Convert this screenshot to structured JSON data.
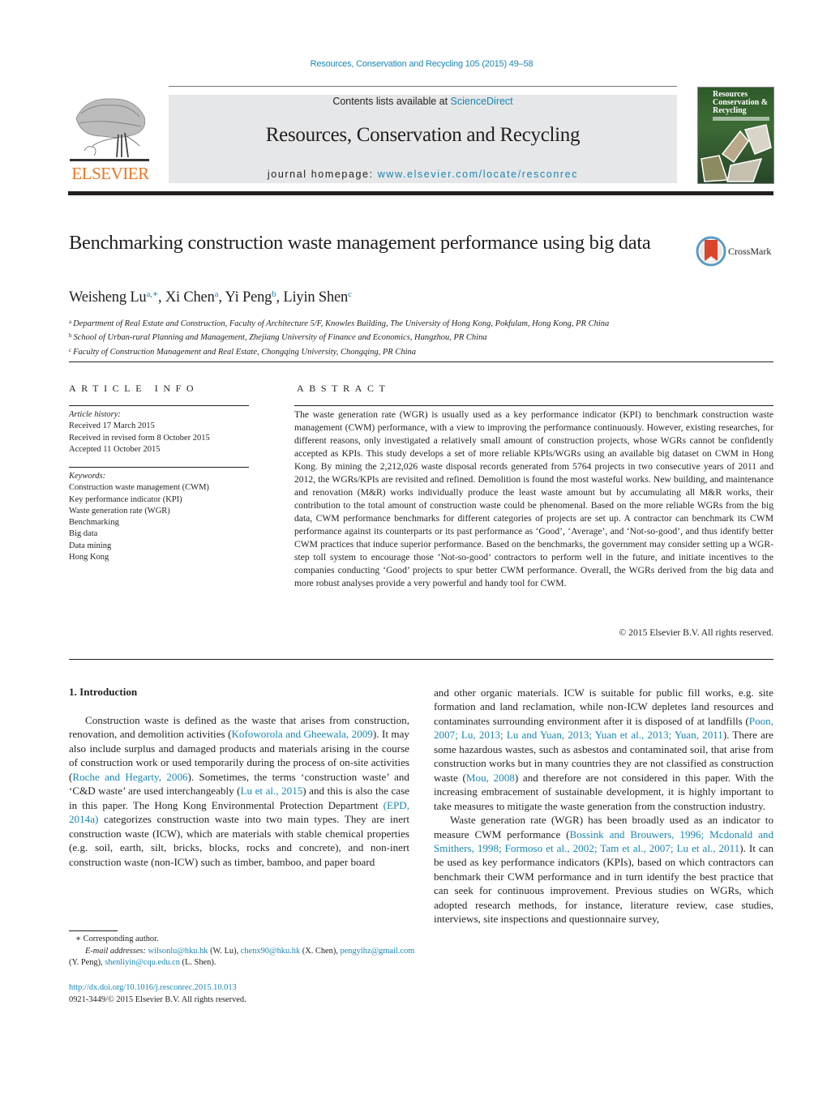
{
  "journal_citation": "Resources, Conservation and Recycling 105 (2015) 49–58",
  "publisher": {
    "logo_text": "ELSEVIER",
    "brand_color": "#e87722"
  },
  "banner": {
    "contents_prefix": "Contents lists available at ",
    "contents_link": "ScienceDirect",
    "journal_name": "Resources, Conservation and Recycling",
    "homepage_prefix": "journal homepage: ",
    "homepage_link": "www.elsevier.com/locate/resconrec"
  },
  "cover": {
    "title_lines": [
      "Resources",
      "Conservation &",
      "Recycling"
    ]
  },
  "crossmark_label": "CrossMark",
  "title": "Benchmarking construction waste management performance using big data",
  "authors": [
    {
      "name": "Weisheng Lu",
      "marks": "a,∗"
    },
    {
      "name": "Xi Chen",
      "marks": "a"
    },
    {
      "name": "Yi Peng",
      "marks": "b"
    },
    {
      "name": "Liyin Shen",
      "marks": "c"
    }
  ],
  "affiliations": [
    {
      "mark": "a",
      "text": "Department of Real Estate and Construction, Faculty of Architecture 5/F, Knowles Building, The University of Hong Kong, Pokfulam, Hong Kong, PR China"
    },
    {
      "mark": "b",
      "text": "School of Urban-rural Planning and Management, Zhejiang University of Finance and Economics, Hangzhou, PR China"
    },
    {
      "mark": "c",
      "text": "Faculty of Construction Management and Real Estate, Chongqing University, Chongqing, PR China"
    }
  ],
  "article_info": {
    "heading": "ARTICLE INFO",
    "history_label": "Article history:",
    "history": [
      "Received 17 March 2015",
      "Received in revised form 8 October 2015",
      "Accepted 11 October 2015"
    ],
    "keywords_label": "Keywords:",
    "keywords": [
      "Construction waste management (CWM)",
      "Key performance indicator (KPI)",
      "Waste generation rate (WGR)",
      "Benchmarking",
      "Big data",
      "Data mining",
      "Hong Kong"
    ]
  },
  "abstract": {
    "heading": "ABSTRACT",
    "text": "The waste generation rate (WGR) is usually used as a key performance indicator (KPI) to benchmark construction waste management (CWM) performance, with a view to improving the performance continuously. However, existing researches, for different reasons, only investigated a relatively small amount of construction projects, whose WGRs cannot be confidently accepted as KPIs. This study develops a set of more reliable KPIs/WGRs using an available big dataset on CWM in Hong Kong. By mining the 2,212,026 waste disposal records generated from 5764 projects in two consecutive years of 2011 and 2012, the WGRs/KPIs are revisited and refined. Demolition is found the most wasteful works. New building, and maintenance and renovation (M&R) works individually produce the least waste amount but by accumulating all M&R works, their contribution to the total amount of construction waste could be phenomenal. Based on the more reliable WGRs from the big data, CWM performance benchmarks for different categories of projects are set up. A contractor can benchmark its CWM performance against its counterparts or its past performance as ‘Good’, ‘Average’, and ‘Not-so-good’, and thus identify better CWM practices that induce superior performance. Based on the benchmarks, the government may consider setting up a WGR-step toll system to encourage those ‘Not-so-good’ contractors to perform well in the future, and initiate incentives to the companies conducting ‘Good’ projects to spur better CWM performance. Overall, the WGRs derived from the big data and more robust analyses provide a very powerful and handy tool for CWM.",
    "copyright": "© 2015 Elsevier B.V. All rights reserved."
  },
  "introduction": {
    "heading": "1.  Introduction",
    "left_p1": [
      {
        "t": "Construction waste is defined as the waste that arises from construction, renovation, and demolition activities ("
      },
      {
        "t": "Kofoworola and Gheewala, 2009",
        "link": true
      },
      {
        "t": "). It may also include surplus and damaged products and materials arising in the course of construction work or used temporarily during the process of on-site activities ("
      },
      {
        "t": "Roche and Hegarty, 2006",
        "link": true
      },
      {
        "t": "). Sometimes, the terms ‘construction waste’ and ‘C&D waste’ are used interchangeably ("
      },
      {
        "t": "Lu et al., 2015",
        "link": true
      },
      {
        "t": ") and this is also the case in this paper. The Hong Kong Environmental Protection Department "
      },
      {
        "t": "(EPD, 2014a)",
        "link": true
      },
      {
        "t": " categorizes construction waste into two main types. They are inert construction waste (ICW), which are materials with stable chemical properties (e.g. soil, earth, silt, bricks, blocks, rocks and concrete), and non-inert construction waste (non-ICW) such as timber, bamboo, and paper board"
      }
    ],
    "right_p1": [
      {
        "t": "and other organic materials. ICW is suitable for public fill works, e.g. site formation and land reclamation, while non-ICW depletes land resources and contaminates surrounding environment after it is disposed of at landfills ("
      },
      {
        "t": "Poon, 2007; Lu, 2013; Lu and Yuan, 2013; Yuan et al., 2013; Yuan, 2011",
        "link": true
      },
      {
        "t": "). There are some hazardous wastes, such as asbestos and contaminated soil, that arise from construction works but in many countries they are not classified as construction waste ("
      },
      {
        "t": "Mou, 2008",
        "link": true
      },
      {
        "t": ") and therefore are not considered in this paper. With the increasing embracement of sustainable development, it is highly important to take measures to mitigate the waste generation from the construction industry."
      }
    ],
    "right_p2": [
      {
        "t": "Waste generation rate (WGR) has been broadly used as an indicator to measure CWM performance ("
      },
      {
        "t": "Bossink and Brouwers, 1996; Mcdonald and Smithers, 1998; Formoso et al., 2002; Tam et al., 2007; Lu et al., 2011",
        "link": true
      },
      {
        "t": "). It can be used as key performance indicators (KPIs), based on which contractors can benchmark their CWM performance and in turn identify the best practice that can seek for continuous improvement. Previous studies on WGRs, which adopted research methods, for instance, literature review, case studies, interviews, site inspections and questionnaire survey,"
      }
    ]
  },
  "footnotes": {
    "corresponding": "∗  Corresponding author.",
    "email_label": "E-mail addresses:",
    "emails": [
      {
        "addr": "wilsonlu@hku.hk",
        "who": " (W. Lu), "
      },
      {
        "addr": "chenx90@hku.hk",
        "who": " (X. Chen), "
      },
      {
        "addr": "pengyihz@gmail.com",
        "who": " (Y. Peng), "
      },
      {
        "addr": "shenliyin@cqu.edu.cn",
        "who": " (L. Shen)."
      }
    ],
    "doi": "http://dx.doi.org/10.1016/j.resconrec.2015.10.013",
    "issn": "0921-3449/© 2015 Elsevier B.V. All rights reserved."
  }
}
